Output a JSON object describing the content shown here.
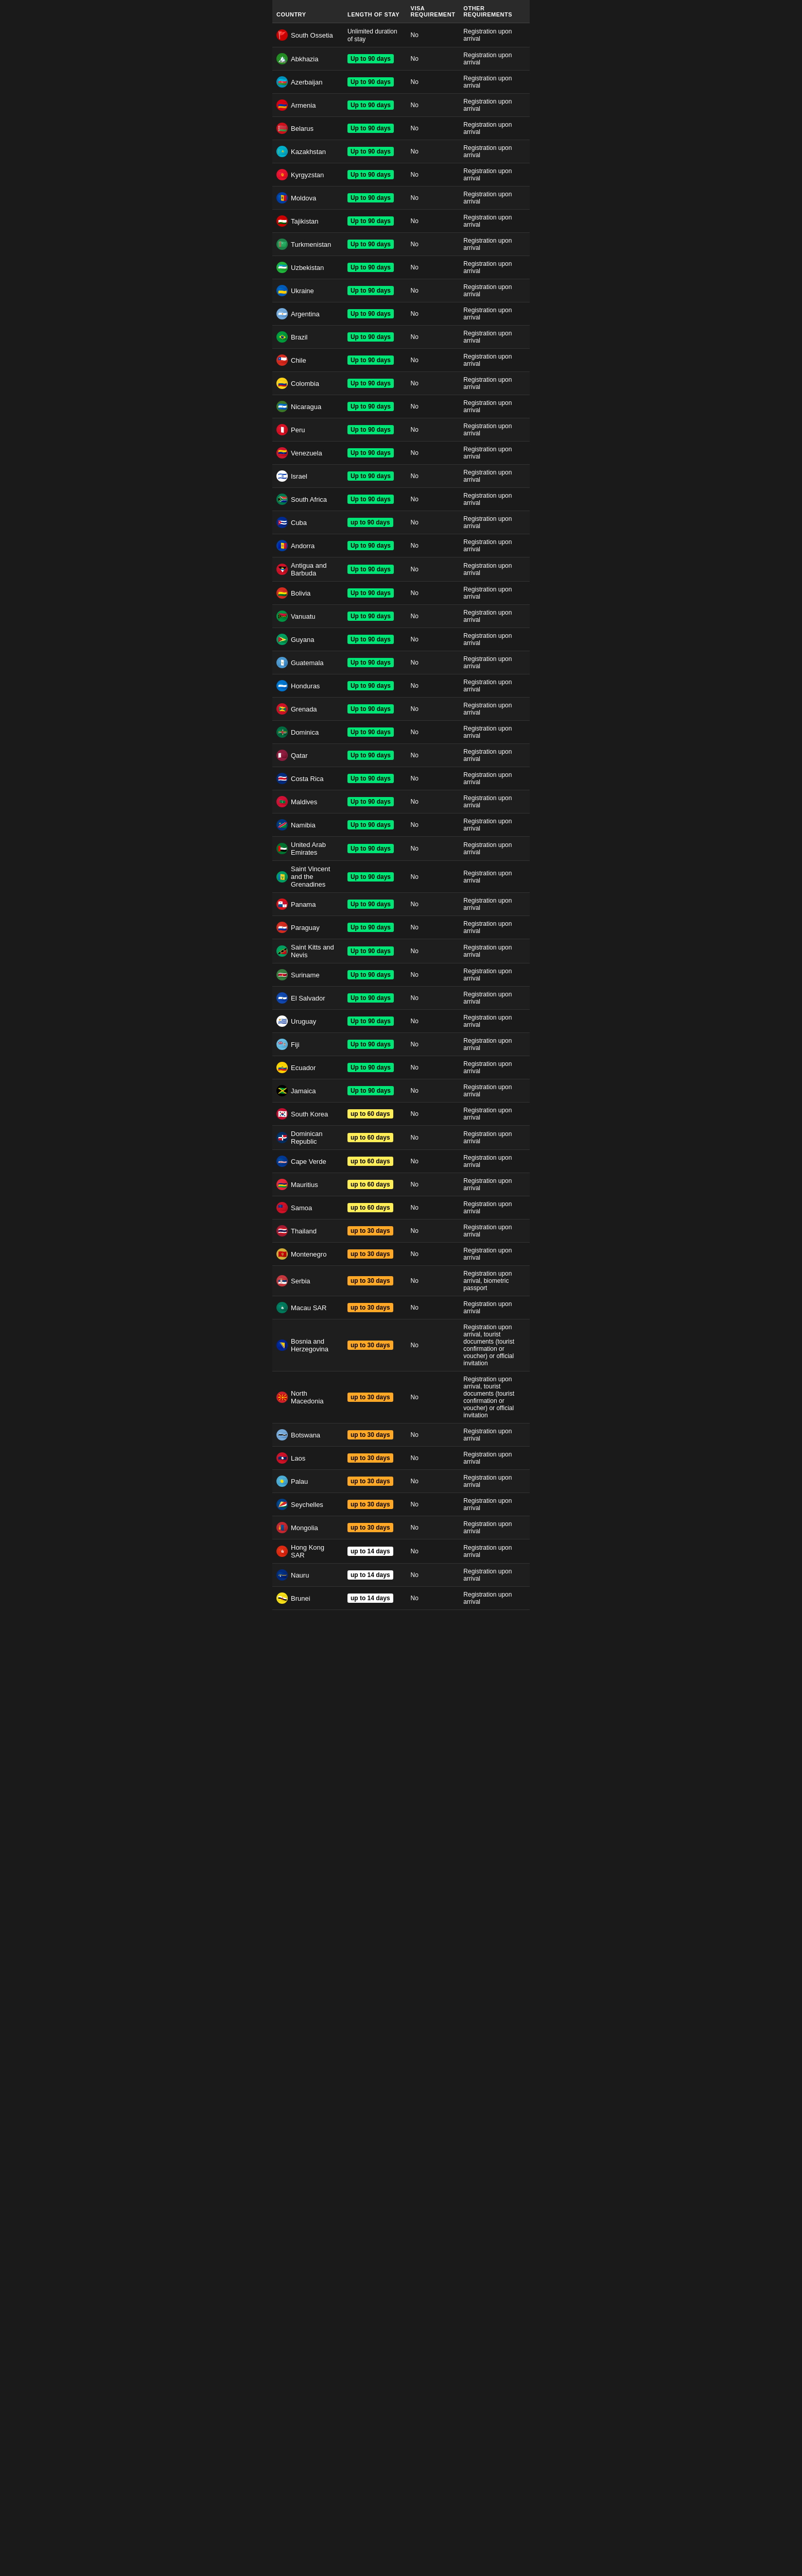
{
  "headers": {
    "country": "COUNTRY",
    "length_of_stay": "LENGTH OF STAY",
    "visa_requirement": "VISA REQUIREMENT",
    "other_requirements": "OTHER REQUIREMENTS"
  },
  "rows": [
    {
      "country": "South Ossetia",
      "flag": "🚩",
      "flag_bg": "#cc0000",
      "stay": "Unlimited duration of stay",
      "stay_class": "stay-text",
      "visa": "No",
      "other": "Registration upon arrival"
    },
    {
      "country": "Abkhazia",
      "flag": "🏔️",
      "flag_bg": "#228B22",
      "stay": "Up to 90 days",
      "stay_class": "stay-green",
      "visa": "No",
      "other": "Registration upon arrival"
    },
    {
      "country": "Azerbaijan",
      "flag": "🇦🇿",
      "flag_bg": "#0092BC",
      "stay": "Up to 90 days",
      "stay_class": "stay-green",
      "visa": "No",
      "other": "Registration upon arrival"
    },
    {
      "country": "Armenia",
      "flag": "🇦🇲",
      "flag_bg": "#D90012",
      "stay": "Up to 90 days",
      "stay_class": "stay-green",
      "visa": "No",
      "other": "Registration upon arrival"
    },
    {
      "country": "Belarus",
      "flag": "🇧🇾",
      "flag_bg": "#CF101A",
      "stay": "Up to 90 days",
      "stay_class": "stay-green",
      "visa": "No",
      "other": "Registration upon arrival"
    },
    {
      "country": "Kazakhstan",
      "flag": "🇰🇿",
      "flag_bg": "#00AFCA",
      "stay": "Up to 90 days",
      "stay_class": "stay-green",
      "visa": "No",
      "other": "Registration upon arrival"
    },
    {
      "country": "Kyrgyzstan",
      "flag": "🇰🇬",
      "flag_bg": "#E8112D",
      "stay": "Up to 90 days",
      "stay_class": "stay-green",
      "visa": "No",
      "other": "Registration upon arrival"
    },
    {
      "country": "Moldova",
      "flag": "🇲🇩",
      "flag_bg": "#003DA5",
      "stay": "Up to 90 days",
      "stay_class": "stay-green",
      "visa": "No",
      "other": "Registration upon arrival"
    },
    {
      "country": "Tajikistan",
      "flag": "🇹🇯",
      "flag_bg": "#CC0001",
      "stay": "Up to 90 days",
      "stay_class": "stay-green",
      "visa": "No",
      "other": "Registration upon arrival"
    },
    {
      "country": "Turkmenistan",
      "flag": "🇹🇲",
      "flag_bg": "#1D8348",
      "stay": "Up to 90 days",
      "stay_class": "stay-green",
      "visa": "No",
      "other": "Registration upon arrival"
    },
    {
      "country": "Uzbekistan",
      "flag": "🇺🇿",
      "flag_bg": "#1EB53A",
      "stay": "Up to 90 days",
      "stay_class": "stay-green",
      "visa": "No",
      "other": "Registration upon arrival"
    },
    {
      "country": "Ukraine",
      "flag": "🇺🇦",
      "flag_bg": "#005BBB",
      "stay": "Up to 90 days",
      "stay_class": "stay-green",
      "visa": "No",
      "other": "Registration upon arrival"
    },
    {
      "country": "Argentina",
      "flag": "🇦🇷",
      "flag_bg": "#74ACDF",
      "stay": "Up to 90 days",
      "stay_class": "stay-green",
      "visa": "No",
      "other": "Registration upon arrival"
    },
    {
      "country": "Brazil",
      "flag": "🇧🇷",
      "flag_bg": "#009C3B",
      "stay": "Up to 90 days",
      "stay_class": "stay-green",
      "visa": "No",
      "other": "Registration upon arrival"
    },
    {
      "country": "Chile",
      "flag": "🇨🇱",
      "flag_bg": "#D52B1E",
      "stay": "Up to 90 days",
      "stay_class": "stay-green",
      "visa": "No",
      "other": "Registration upon arrival"
    },
    {
      "country": "Colombia",
      "flag": "🇨🇴",
      "flag_bg": "#FCD116",
      "stay": "Up to 90 days",
      "stay_class": "stay-green",
      "visa": "No",
      "other": "Registration upon arrival"
    },
    {
      "country": "Nicaragua",
      "flag": "🇳🇮",
      "flag_bg": "#3A7728",
      "stay": "Up to 90 days",
      "stay_class": "stay-green",
      "visa": "No",
      "other": "Registration upon arrival"
    },
    {
      "country": "Peru",
      "flag": "🇵🇪",
      "flag_bg": "#D91023",
      "stay": "Up to 90 days",
      "stay_class": "stay-green",
      "visa": "No",
      "other": "Registration upon arrival"
    },
    {
      "country": "Venezuela",
      "flag": "🇻🇪",
      "flag_bg": "#CF142B",
      "stay": "Up to 90 days",
      "stay_class": "stay-green",
      "visa": "No",
      "other": "Registration upon arrival"
    },
    {
      "country": "Israel",
      "flag": "🇮🇱",
      "flag_bg": "#ffffff",
      "stay": "Up to 90 days",
      "stay_class": "stay-green",
      "visa": "No",
      "other": "Registration upon arrival"
    },
    {
      "country": "South Africa",
      "flag": "🇿🇦",
      "flag_bg": "#007A4D",
      "stay": "Up to 90 days",
      "stay_class": "stay-green",
      "visa": "No",
      "other": "Registration upon arrival"
    },
    {
      "country": "Cuba",
      "flag": "🇨🇺",
      "flag_bg": "#002A8F",
      "stay": "up to 90 days",
      "stay_class": "stay-green",
      "visa": "No",
      "other": "Registration upon arrival"
    },
    {
      "country": "Andorra",
      "flag": "🇦🇩",
      "flag_bg": "#003DA5",
      "stay": "Up to 90 days",
      "stay_class": "stay-green",
      "visa": "No",
      "other": "Registration upon arrival"
    },
    {
      "country": "Antigua and Barbuda",
      "flag": "🇦🇬",
      "flag_bg": "#CE1126",
      "stay": "Up to 90 days",
      "stay_class": "stay-green",
      "visa": "No",
      "other": "Registration upon arrival"
    },
    {
      "country": "Bolivia",
      "flag": "🇧🇴",
      "flag_bg": "#D52B1E",
      "stay": "Up to 90 days",
      "stay_class": "stay-green",
      "visa": "No",
      "other": "Registration upon arrival"
    },
    {
      "country": "Vanuatu",
      "flag": "🇻🇺",
      "flag_bg": "#009543",
      "stay": "Up to 90 days",
      "stay_class": "stay-green",
      "visa": "No",
      "other": "Registration upon arrival"
    },
    {
      "country": "Guyana",
      "flag": "🇬🇾",
      "flag_bg": "#009E60",
      "stay": "Up to 90 days",
      "stay_class": "stay-green",
      "visa": "No",
      "other": "Registration upon arrival"
    },
    {
      "country": "Guatemala",
      "flag": "🇬🇹",
      "flag_bg": "#4997D0",
      "stay": "Up to 90 days",
      "stay_class": "stay-green",
      "visa": "No",
      "other": "Registration upon arrival"
    },
    {
      "country": "Honduras",
      "flag": "🇭🇳",
      "flag_bg": "#0073CF",
      "stay": "Up to 90 days",
      "stay_class": "stay-green",
      "visa": "No",
      "other": "Registration upon arrival"
    },
    {
      "country": "Grenada",
      "flag": "🇬🇩",
      "flag_bg": "#CE1126",
      "stay": "Up to 90 days",
      "stay_class": "stay-green",
      "visa": "No",
      "other": "Registration upon arrival"
    },
    {
      "country": "Dominica",
      "flag": "🇩🇲",
      "flag_bg": "#006B3F",
      "stay": "Up to 90 days",
      "stay_class": "stay-green",
      "visa": "No",
      "other": "Registration upon arrival"
    },
    {
      "country": "Qatar",
      "flag": "🇶🇦",
      "flag_bg": "#8D1B3D",
      "stay": "Up to 90 days",
      "stay_class": "stay-green",
      "visa": "No",
      "other": "Registration upon arrival"
    },
    {
      "country": "Costa Rica",
      "flag": "🇨🇷",
      "flag_bg": "#002B7F",
      "stay": "Up to 90 days",
      "stay_class": "stay-green",
      "visa": "No",
      "other": "Registration upon arrival"
    },
    {
      "country": "Maldives",
      "flag": "🇲🇻",
      "flag_bg": "#D21034",
      "stay": "Up to 90 days",
      "stay_class": "stay-green",
      "visa": "No",
      "other": "Registration upon arrival"
    },
    {
      "country": "Namibia",
      "flag": "🇳🇦",
      "flag_bg": "#003580",
      "stay": "Up to 90 days",
      "stay_class": "stay-green",
      "visa": "No",
      "other": "Registration upon arrival"
    },
    {
      "country": "United Arab Emirates",
      "flag": "🇦🇪",
      "flag_bg": "#00732F",
      "stay": "Up to 90 days",
      "stay_class": "stay-green",
      "visa": "No",
      "other": "Registration upon arrival"
    },
    {
      "country": "Saint Vincent and the Grenadines",
      "flag": "🇻🇨",
      "flag_bg": "#009E60",
      "stay": "Up to 90 days",
      "stay_class": "stay-green",
      "visa": "No",
      "other": "Registration upon arrival"
    },
    {
      "country": "Panama",
      "flag": "🇵🇦",
      "flag_bg": "#DA121A",
      "stay": "Up to 90 days",
      "stay_class": "stay-green",
      "visa": "No",
      "other": "Registration upon arrival"
    },
    {
      "country": "Paraguay",
      "flag": "🇵🇾",
      "flag_bg": "#D52B1E",
      "stay": "Up to 90 days",
      "stay_class": "stay-green",
      "visa": "No",
      "other": "Registration upon arrival"
    },
    {
      "country": "Saint Kitts and Nevis",
      "flag": "🇰🇳",
      "flag_bg": "#009E60",
      "stay": "Up to 90 days",
      "stay_class": "stay-green",
      "visa": "No",
      "other": "Registration upon arrival"
    },
    {
      "country": "Suriname",
      "flag": "🇸🇷",
      "flag_bg": "#377E3F",
      "stay": "Up to 90 days",
      "stay_class": "stay-green",
      "visa": "No",
      "other": "Registration upon arrival"
    },
    {
      "country": "El Salvador",
      "flag": "🇸🇻",
      "flag_bg": "#0F47AF",
      "stay": "Up to 90 days",
      "stay_class": "stay-green",
      "visa": "No",
      "other": "Registration upon arrival"
    },
    {
      "country": "Uruguay",
      "flag": "🇺🇾",
      "flag_bg": "#FFFFFF",
      "stay": "Up to 90 days",
      "stay_class": "stay-green",
      "visa": "No",
      "other": "Registration upon arrival"
    },
    {
      "country": "Fiji",
      "flag": "🇫🇯",
      "flag_bg": "#68BFE5",
      "stay": "Up to 90 days",
      "stay_class": "stay-green",
      "visa": "No",
      "other": "Registration upon arrival"
    },
    {
      "country": "Ecuador",
      "flag": "🇪🇨",
      "flag_bg": "#FFD100",
      "stay": "Up to 90 days",
      "stay_class": "stay-green",
      "visa": "No",
      "other": "Registration upon arrival"
    },
    {
      "country": "Jamaica",
      "flag": "🇯🇲",
      "flag_bg": "#000000",
      "stay": "Up to 90 days",
      "stay_class": "stay-green",
      "visa": "No",
      "other": "Registration upon arrival"
    },
    {
      "country": "South Korea",
      "flag": "🇰🇷",
      "flag_bg": "#C60C30",
      "stay": "up to 60 days",
      "stay_class": "stay-yellow",
      "visa": "No",
      "other": "Registration upon arrival"
    },
    {
      "country": "Dominican Republic",
      "flag": "🇩🇴",
      "flag_bg": "#002D62",
      "stay": "up to 60 days",
      "stay_class": "stay-yellow",
      "visa": "No",
      "other": "Registration upon arrival"
    },
    {
      "country": "Cape Verde",
      "flag": "🇨🇻",
      "flag_bg": "#003893",
      "stay": "up to 60 days",
      "stay_class": "stay-yellow",
      "visa": "No",
      "other": "Registration upon arrival"
    },
    {
      "country": "Mauritius",
      "flag": "🇲🇺",
      "flag_bg": "#EA2839",
      "stay": "up to 60 days",
      "stay_class": "stay-yellow",
      "visa": "No",
      "other": "Registration upon arrival"
    },
    {
      "country": "Samoa",
      "flag": "🇼🇸",
      "flag_bg": "#CE1126",
      "stay": "up to 60 days",
      "stay_class": "stay-yellow",
      "visa": "No",
      "other": "Registration upon arrival"
    },
    {
      "country": "Thailand",
      "flag": "🇹🇭",
      "flag_bg": "#A51931",
      "stay": "up to 30 days",
      "stay_class": "stay-orange",
      "visa": "No",
      "other": "Registration upon arrival"
    },
    {
      "country": "Montenegro",
      "flag": "🇲🇪",
      "flag_bg": "#D4AF37",
      "stay": "up to 30 days",
      "stay_class": "stay-orange",
      "visa": "No",
      "other": "Registration upon arrival"
    },
    {
      "country": "Serbia",
      "flag": "🇷🇸",
      "flag_bg": "#C6363C",
      "stay": "up to 30 days",
      "stay_class": "stay-orange",
      "visa": "No",
      "other": "Registration upon arrival, biometric passport"
    },
    {
      "country": "Macau SAR",
      "flag": "🇲🇴",
      "flag_bg": "#00785A",
      "stay": "up to 30 days",
      "stay_class": "stay-orange",
      "visa": "No",
      "other": "Registration upon arrival"
    },
    {
      "country": "Bosnia and Herzegovina",
      "flag": "🇧🇦",
      "flag_bg": "#002395",
      "stay": "up to 30 days",
      "stay_class": "stay-orange",
      "visa": "No",
      "other": "Registration upon arrival, tourist documents (tourist confirmation or voucher) or official invitation"
    },
    {
      "country": "North Macedonia",
      "flag": "🇲🇰",
      "flag_bg": "#CE2028",
      "stay": "up to 30 days",
      "stay_class": "stay-orange",
      "visa": "No",
      "other": "Registration upon arrival, tourist documents (tourist confirmation or voucher) or official invitation"
    },
    {
      "country": "Botswana",
      "flag": "🇧🇼",
      "flag_bg": "#75AADB",
      "stay": "up to 30 days",
      "stay_class": "stay-orange",
      "visa": "No",
      "other": "Registration upon arrival"
    },
    {
      "country": "Laos",
      "flag": "🇱🇦",
      "flag_bg": "#CE1126",
      "stay": "up to 30 days",
      "stay_class": "stay-orange",
      "visa": "No",
      "other": "Registration upon arrival"
    },
    {
      "country": "Palau",
      "flag": "🇵🇼",
      "flag_bg": "#4AADD6",
      "stay": "up to 30 days",
      "stay_class": "stay-orange",
      "visa": "No",
      "other": "Registration upon arrival"
    },
    {
      "country": "Seychelles",
      "flag": "🇸🇨",
      "flag_bg": "#003F87",
      "stay": "up to 30 days",
      "stay_class": "stay-orange",
      "visa": "No",
      "other": "Registration upon arrival"
    },
    {
      "country": "Mongolia",
      "flag": "🇲🇳",
      "flag_bg": "#C4272F",
      "stay": "up to 30 days",
      "stay_class": "stay-orange",
      "visa": "No",
      "other": "Registration upon arrival"
    },
    {
      "country": "Hong Kong SAR",
      "flag": "🇭🇰",
      "flag_bg": "#DE2910",
      "stay": "up to 14 days",
      "stay_class": "stay-white",
      "visa": "No",
      "other": "Registration upon arrival"
    },
    {
      "country": "Nauru",
      "flag": "🇳🇷",
      "flag_bg": "#002B7F",
      "stay": "up to 14 days",
      "stay_class": "stay-white",
      "visa": "No",
      "other": "Registration upon arrival"
    },
    {
      "country": "Brunei",
      "flag": "🇧🇳",
      "flag_bg": "#F7E017",
      "stay": "up to 14 days",
      "stay_class": "stay-white",
      "visa": "No",
      "other": "Registration upon arrival"
    }
  ]
}
